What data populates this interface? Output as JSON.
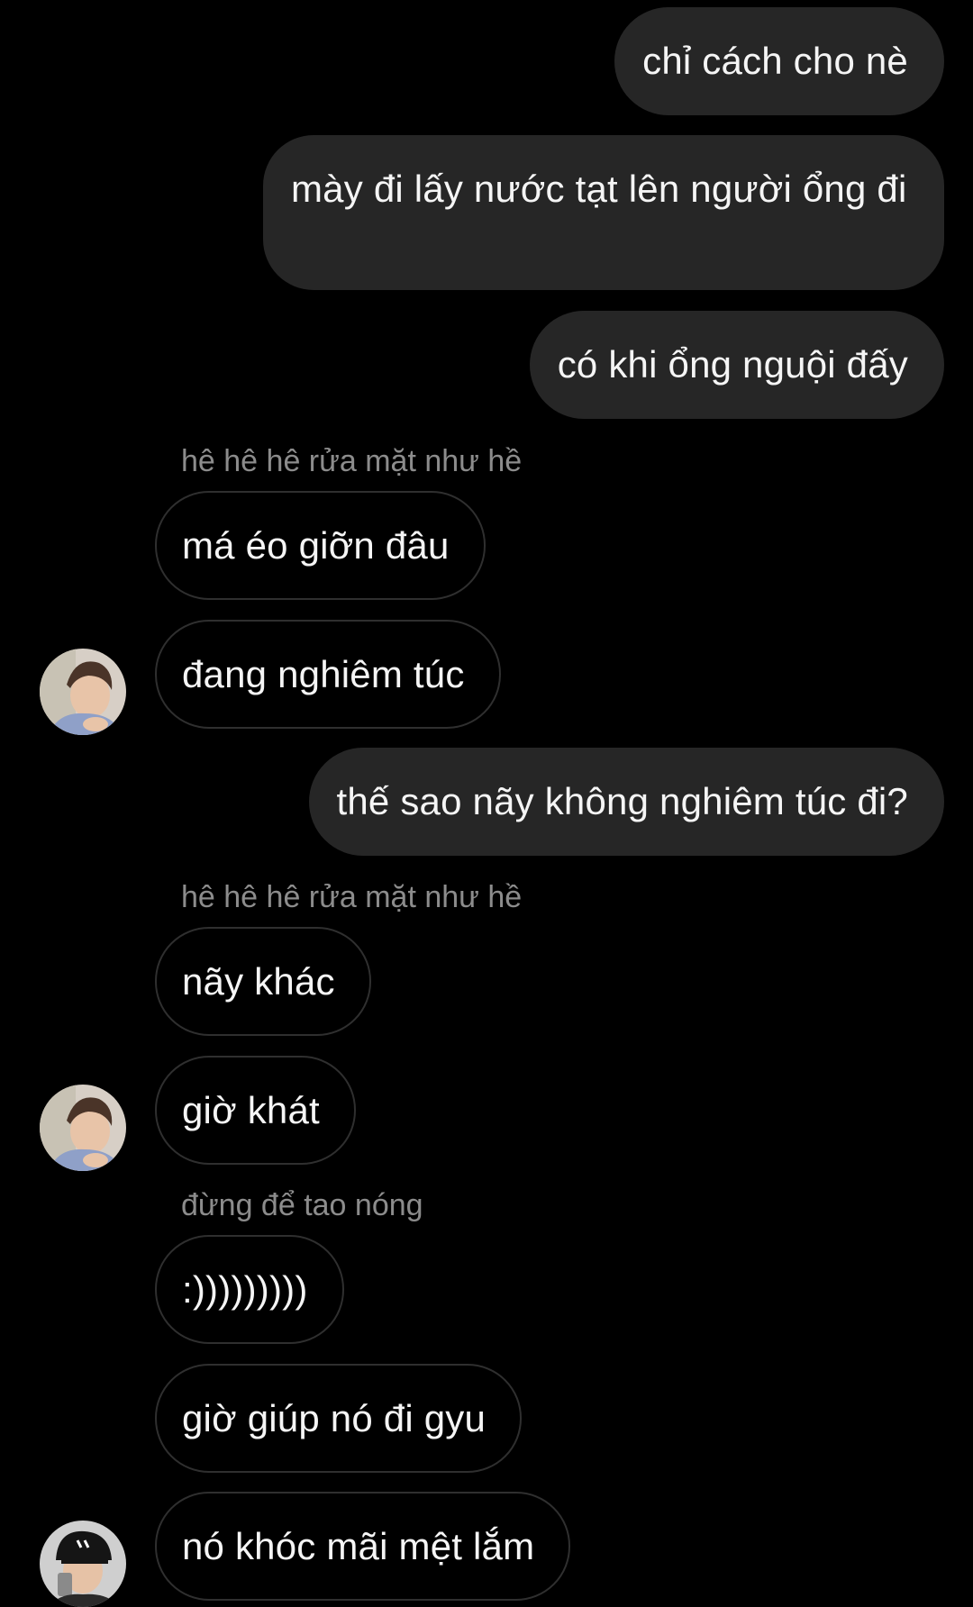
{
  "messages": [
    {
      "id": "m1",
      "direction": "outgoing",
      "text": "chỉ cách cho nè"
    },
    {
      "id": "m2",
      "direction": "outgoing",
      "text": "mày đi lấy nước tạt lên người ổng đi"
    },
    {
      "id": "m3",
      "direction": "outgoing",
      "text": "có khi ổng nguội đấy"
    },
    {
      "id": "m4",
      "direction": "incoming",
      "reply_to": "hê hê hê rửa mặt như hề",
      "text": "má éo giỡn đâu"
    },
    {
      "id": "m5",
      "direction": "incoming",
      "text": "đang nghiêm túc"
    },
    {
      "id": "m6",
      "direction": "outgoing",
      "text": "thế sao nãy không nghiêm túc đi?"
    },
    {
      "id": "m7",
      "direction": "incoming",
      "reply_to": "hê hê hê rửa mặt như hề",
      "text": "nãy khác"
    },
    {
      "id": "m8",
      "direction": "incoming",
      "text": "giờ khát"
    },
    {
      "id": "m9",
      "direction": "incoming",
      "reply_to": "đừng để tao nóng",
      "text": ":)))))))))"
    },
    {
      "id": "m10",
      "direction": "incoming",
      "text": "giờ giúp nó đi gyu"
    },
    {
      "id": "m11",
      "direction": "incoming",
      "text": "nó khóc mãi mệt lắm"
    }
  ],
  "avatars": [
    {
      "id": "a1",
      "icon": "user-avatar-photo-brown-hair"
    },
    {
      "id": "a2",
      "icon": "user-avatar-photo-brown-hair"
    },
    {
      "id": "a3",
      "icon": "user-avatar-photo-black-cap"
    }
  ],
  "colors": {
    "background": "#000000",
    "outgoing_bubble": "#262626",
    "incoming_border": "#2f2f2f",
    "reply_label": "#8c8c8c",
    "text": "#f5f5f5"
  }
}
